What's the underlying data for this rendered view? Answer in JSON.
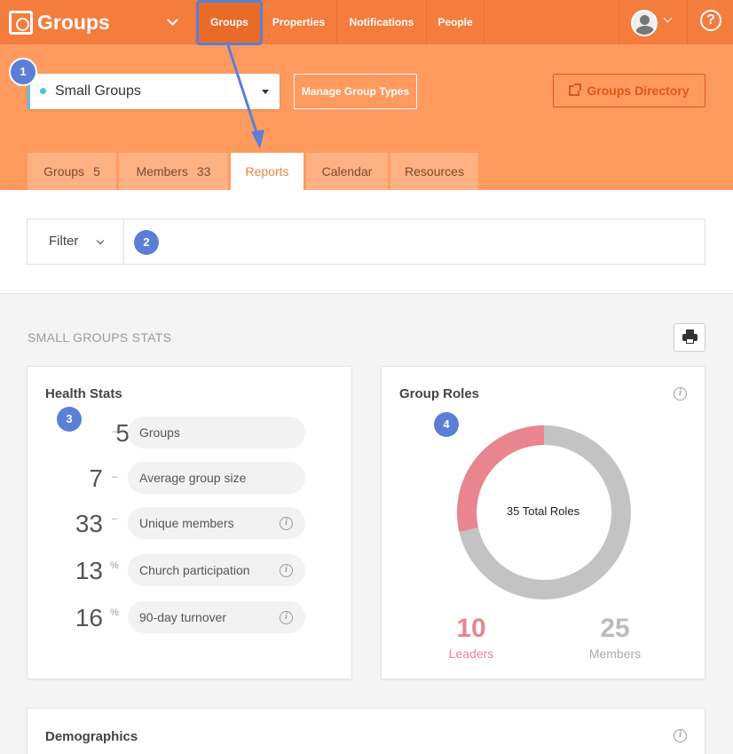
{
  "brand": {
    "name": "Groups"
  },
  "nav": {
    "items": [
      {
        "label": "Groups"
      },
      {
        "label": "Properties"
      },
      {
        "label": "Notifications"
      },
      {
        "label": "People"
      }
    ],
    "help": "?"
  },
  "toolbar": {
    "group_type": "Small Groups",
    "manage_label": "Manage Group Types",
    "directory_label": "Groups Directory"
  },
  "tabs": [
    {
      "label": "Groups",
      "count": "5"
    },
    {
      "label": "Members",
      "count": "33"
    },
    {
      "label": "Reports",
      "count": ""
    },
    {
      "label": "Calendar",
      "count": ""
    },
    {
      "label": "Resources",
      "count": ""
    }
  ],
  "filter": {
    "label": "Filter"
  },
  "stats_title": "SMALL GROUPS STATS",
  "health": {
    "title": "Health Stats",
    "rows": [
      {
        "value": "5",
        "unit": "–",
        "label": "Groups"
      },
      {
        "value": "7",
        "unit": "–",
        "label": "Average group size"
      },
      {
        "value": "33",
        "unit": "–",
        "label": "Unique members"
      },
      {
        "value": "13",
        "unit": "%",
        "label": "Church participation"
      },
      {
        "value": "16",
        "unit": "%",
        "label": "90-day turnover"
      }
    ]
  },
  "roles": {
    "title": "Group Roles",
    "center": "35 Total Roles",
    "leaders": {
      "value": "10",
      "label": "Leaders",
      "color": "#e8858f"
    },
    "members": {
      "value": "25",
      "label": "Members",
      "color": "#c3c3c3"
    }
  },
  "demographics": {
    "title": "Demographics"
  },
  "annotations": [
    "1",
    "2",
    "3",
    "4"
  ],
  "colors": {
    "primary": "#f47c3c",
    "band": "#ff9a5f",
    "annotation": "#5b7fd6"
  }
}
